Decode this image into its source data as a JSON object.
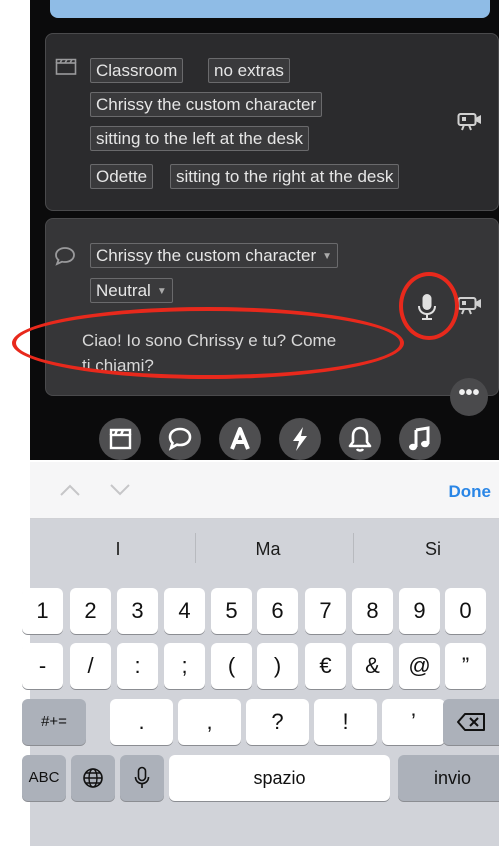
{
  "scene_card": {
    "row1": [
      "Classroom",
      "no extras"
    ],
    "row2": "Chrissy the custom character",
    "row3": "sitting to the left at the desk",
    "row4": [
      "Odette",
      "sitting to the right at the desk"
    ]
  },
  "dialog_card": {
    "character": "Chrissy the custom character",
    "emotion": "Neutral",
    "text_line1": "Ciao! Io sono Chrissy e tu? Come",
    "text_line2": "ti chiami?"
  },
  "more_label": "•••",
  "toolbar_icons": [
    "clapperboard-icon",
    "speech-bubble-icon",
    "text-a-icon",
    "lightning-icon",
    "bell-icon",
    "music-note-icon"
  ],
  "keyboard_toolbar": {
    "done": "Done"
  },
  "suggestions": [
    "I",
    "Ma",
    "Si"
  ],
  "keyboard": {
    "row1": [
      "1",
      "2",
      "3",
      "4",
      "5",
      "6",
      "7",
      "8",
      "9",
      "0"
    ],
    "row2": [
      "-",
      "/",
      ":",
      ";",
      "(",
      ")",
      "€",
      "&",
      "@",
      "”"
    ],
    "row3_left": "#+=",
    "row3": [
      ".",
      ",",
      "?",
      "!",
      "’"
    ],
    "abc": "ABC",
    "space": "spazio",
    "return": "invio"
  },
  "colors": {
    "accent_blue": "#2a86e6",
    "annotation_red": "#e8291c",
    "app_background": "#0b0b0c"
  }
}
